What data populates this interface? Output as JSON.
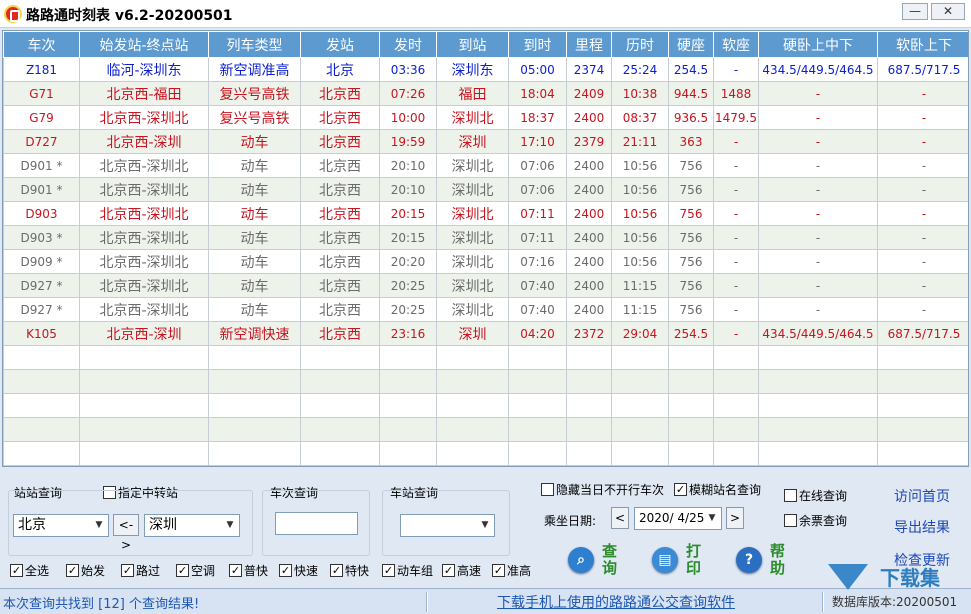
{
  "window": {
    "title": "路路通时刻表 v6.2-20200501",
    "minimize": "—",
    "close": "✕"
  },
  "colors": {
    "header_bg": "#5d9ad0",
    "red": "#c8141e",
    "blue": "#0b1fd0",
    "gray": "#6b6b6b",
    "link": "#1f49b4"
  },
  "table": {
    "headers": [
      "车次",
      "始发站-终点站",
      "列车类型",
      "发站",
      "发时",
      "到站",
      "到时",
      "里程",
      "历时",
      "硬座",
      "软座",
      "硬卧上中下",
      "软卧上下"
    ],
    "rows": [
      {
        "color": "blue",
        "cells": [
          "Z181",
          "临河-深圳东",
          "新空调准高",
          "北京",
          "03:36",
          "深圳东",
          "05:00",
          "2374",
          "25:24",
          "254.5",
          "-",
          "434.5/449.5/464.5",
          "687.5/717.5"
        ]
      },
      {
        "color": "red",
        "cells": [
          "G71",
          "北京西-福田",
          "复兴号高铁",
          "北京西",
          "07:26",
          "福田",
          "18:04",
          "2409",
          "10:38",
          "944.5",
          "1488",
          "-",
          "-"
        ]
      },
      {
        "color": "red",
        "cells": [
          "G79",
          "北京西-深圳北",
          "复兴号高铁",
          "北京西",
          "10:00",
          "深圳北",
          "18:37",
          "2400",
          "08:37",
          "936.5",
          "1479.5",
          "-",
          "-"
        ]
      },
      {
        "color": "red",
        "cells": [
          "D727",
          "北京西-深圳",
          "动车",
          "北京西",
          "19:59",
          "深圳",
          "17:10",
          "2379",
          "21:11",
          "363",
          "-",
          "-",
          "-"
        ]
      },
      {
        "color": "gray",
        "cells": [
          "D901 *",
          "北京西-深圳北",
          "动车",
          "北京西",
          "20:10",
          "深圳北",
          "07:06",
          "2400",
          "10:56",
          "756",
          "-",
          "-",
          "-"
        ]
      },
      {
        "color": "gray",
        "cells": [
          "D901 *",
          "北京西-深圳北",
          "动车",
          "北京西",
          "20:10",
          "深圳北",
          "07:06",
          "2400",
          "10:56",
          "756",
          "-",
          "-",
          "-"
        ]
      },
      {
        "color": "red",
        "cells": [
          "D903",
          "北京西-深圳北",
          "动车",
          "北京西",
          "20:15",
          "深圳北",
          "07:11",
          "2400",
          "10:56",
          "756",
          "-",
          "-",
          "-"
        ]
      },
      {
        "color": "gray",
        "cells": [
          "D903 *",
          "北京西-深圳北",
          "动车",
          "北京西",
          "20:15",
          "深圳北",
          "07:11",
          "2400",
          "10:56",
          "756",
          "-",
          "-",
          "-"
        ]
      },
      {
        "color": "gray",
        "cells": [
          "D909 *",
          "北京西-深圳北",
          "动车",
          "北京西",
          "20:20",
          "深圳北",
          "07:16",
          "2400",
          "10:56",
          "756",
          "-",
          "-",
          "-"
        ]
      },
      {
        "color": "gray",
        "cells": [
          "D927 *",
          "北京西-深圳北",
          "动车",
          "北京西",
          "20:25",
          "深圳北",
          "07:40",
          "2400",
          "11:15",
          "756",
          "-",
          "-",
          "-"
        ]
      },
      {
        "color": "gray",
        "cells": [
          "D927 *",
          "北京西-深圳北",
          "动车",
          "北京西",
          "20:25",
          "深圳北",
          "07:40",
          "2400",
          "11:15",
          "756",
          "-",
          "-",
          "-"
        ]
      },
      {
        "color": "red",
        "cells": [
          "K105",
          "北京西-深圳",
          "新空调快速",
          "北京西",
          "23:16",
          "深圳",
          "04:20",
          "2372",
          "29:04",
          "254.5",
          "-",
          "434.5/449.5/464.5",
          "687.5/717.5"
        ]
      }
    ],
    "empty_rows": 5
  },
  "station_query": {
    "title": "站站查询",
    "transfer_label": "指定中转站",
    "from": "北京",
    "swap": "<->",
    "to": "深圳"
  },
  "train_query": {
    "title": "车次查询",
    "value": ""
  },
  "stop_query": {
    "title": "车站查询",
    "value": ""
  },
  "filters": [
    {
      "label": "全选",
      "checked": true
    },
    {
      "label": "始发",
      "checked": true
    },
    {
      "label": "路过",
      "checked": true
    },
    {
      "label": "空调",
      "checked": true
    },
    {
      "label": "普快",
      "checked": true
    },
    {
      "label": "快速",
      "checked": true
    },
    {
      "label": "特快",
      "checked": true
    },
    {
      "label": "动车组",
      "checked": true
    },
    {
      "label": "高速",
      "checked": true
    },
    {
      "label": "准高",
      "checked": true
    }
  ],
  "options": {
    "hide_not_running": {
      "label": "隐藏当日不开行车次",
      "checked": false
    },
    "fuzzy_station": {
      "label": "模糊站名查询",
      "checked": true
    },
    "online_query": {
      "label": "在线查询",
      "checked": false
    },
    "ticket_query": {
      "label": "余票查询",
      "checked": false
    }
  },
  "date": {
    "label": "乘坐日期:",
    "value": "2020/ 4/25",
    "prev": "<",
    "next": ">"
  },
  "actions": {
    "query": {
      "label": "查询",
      "icon": "magnifier-icon"
    },
    "print": {
      "label": "打印",
      "icon": "printer-icon"
    },
    "help": {
      "label": "帮助",
      "icon": "help-icon"
    }
  },
  "links": {
    "home": "访问首页",
    "export": "导出结果",
    "update": "检查更新"
  },
  "status": {
    "left": "本次查询共找到 [12] 个查询结果!",
    "middle": "下载手机上使用的路路通公交查询软件",
    "right": "数据库版本:20200501"
  },
  "watermark": {
    "text": "下载集"
  }
}
